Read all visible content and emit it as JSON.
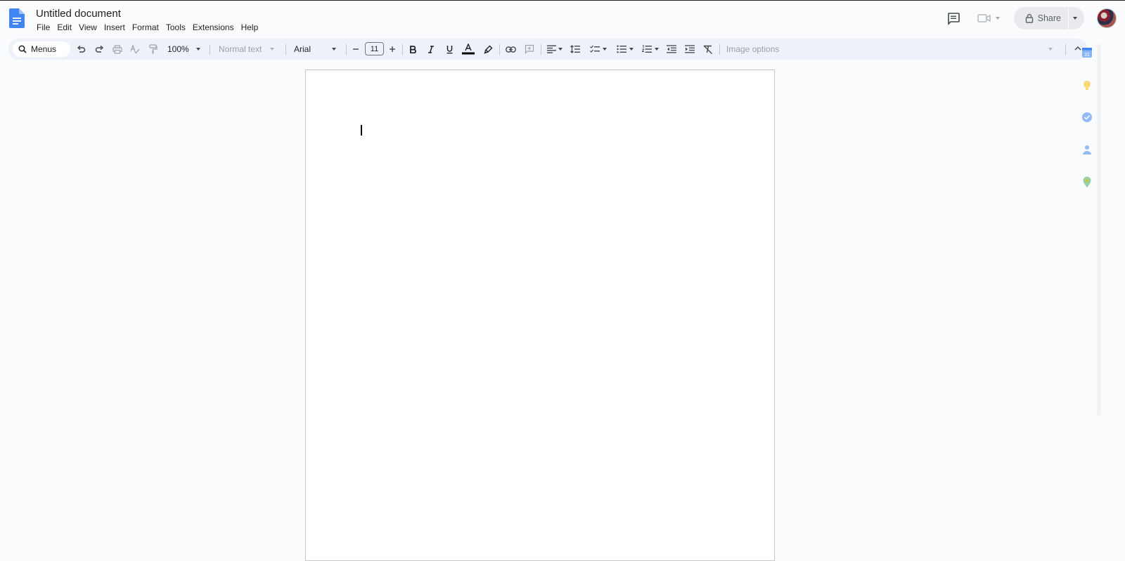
{
  "app": {
    "title": "Untitled document",
    "menus": [
      "File",
      "Edit",
      "View",
      "Insert",
      "Format",
      "Tools",
      "Extensions",
      "Help"
    ]
  },
  "header": {
    "comment_icon": "comment-icon",
    "meet_icon": "video-camera-icon",
    "share_label": "Share",
    "lock_icon": "lock-icon"
  },
  "toolbar": {
    "search_label": "Menus",
    "zoom": "100%",
    "style": "Normal text",
    "font": "Arial",
    "font_size": "11",
    "image_options": "Image options",
    "icons": [
      "undo-icon",
      "redo-icon",
      "print-icon",
      "spellcheck-icon",
      "paint-format-icon",
      "decrease-font-icon",
      "increase-font-icon",
      "bold-icon",
      "italic-icon",
      "underline-icon",
      "text-color-icon",
      "highlight-icon",
      "link-icon",
      "add-comment-icon",
      "align-icon",
      "line-spacing-icon",
      "checklist-icon",
      "bulleted-list-icon",
      "numbered-list-icon",
      "decrease-indent-icon",
      "increase-indent-icon",
      "clear-formatting-icon"
    ]
  },
  "side_panel": {
    "calendar_badge": "31",
    "icons": [
      "calendar-icon",
      "keep-icon",
      "tasks-icon",
      "contacts-icon",
      "maps-icon"
    ]
  },
  "colors": {
    "background": "#f9fbfd",
    "toolbar": "#edf2fa",
    "docs_blue": "#4285f4",
    "share_button": "#e8eaed"
  }
}
